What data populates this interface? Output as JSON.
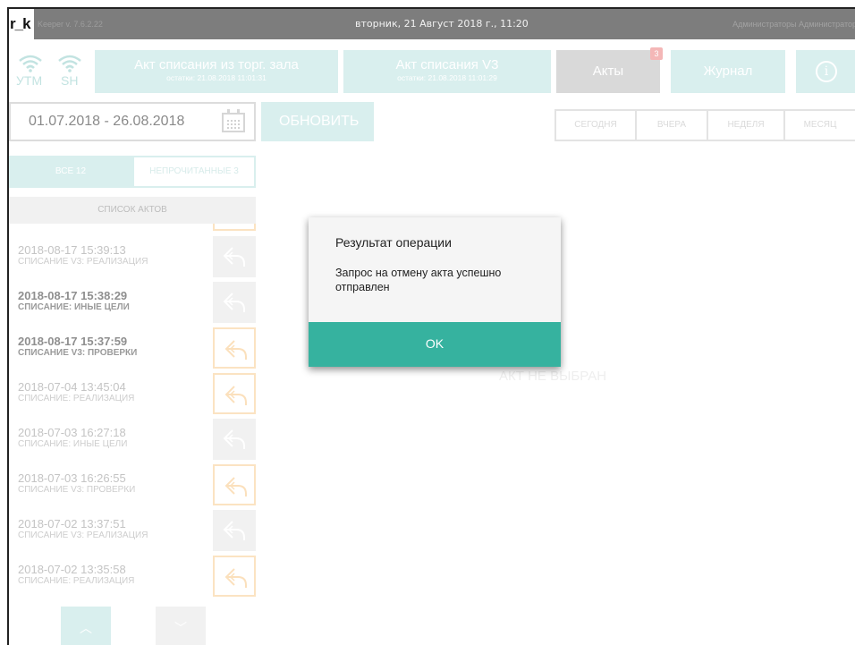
{
  "titlebar": {
    "logo": "r_k",
    "app_version": "Keeper v. 7.6.2.22",
    "datetime": "вторник, 21 Август 2018 г., 11:20",
    "user": "Администраторы Администратор"
  },
  "status": {
    "utm_label": "УТМ",
    "sh_label": "SH"
  },
  "toolbar": {
    "tile1_title": "Акт списания из торг. зала",
    "tile1_sub": "остатки: 21.08.2018 11:01:31",
    "tile2_title": "Акт списания V3",
    "tile2_sub": "остатки: 21.08.2018 11:01:29",
    "acts_label": "Акты",
    "acts_badge": "3",
    "journal_label": "Журнал",
    "info_icon": "i"
  },
  "filters": {
    "date_range": "01.07.2018 - 26.08.2018",
    "refresh_label": "ОБНОВИТЬ",
    "periods": [
      "СЕГОДНЯ",
      "ВЧЕРА",
      "НЕДЕЛЯ",
      "МЕСЯЦ"
    ]
  },
  "sidebar": {
    "all_label": "ВСЕ 12",
    "unread_label": "НЕПРОЧИТАННЫЕ 3",
    "list_header": "СПИСОК АКТОВ",
    "items": [
      {
        "datetime": "2018-08-17  15:39:13",
        "type": "СПИСАНИЕ V3: РЕАЛИЗАЦИЯ",
        "bold": false,
        "undo": "grey"
      },
      {
        "datetime": "2018-08-17  15:38:29",
        "type": "СПИСАНИЕ: ИНЫЕ ЦЕЛИ",
        "bold": true,
        "undo": "grey"
      },
      {
        "datetime": "2018-08-17  15:37:59",
        "type": "СПИСАНИЕ V3: ПРОВЕРКИ",
        "bold": true,
        "undo": "orange"
      },
      {
        "datetime": "2018-07-04  13:45:04",
        "type": "СПИСАНИЕ: РЕАЛИЗАЦИЯ",
        "bold": false,
        "undo": "orange"
      },
      {
        "datetime": "2018-07-03  16:27:18",
        "type": "СПИСАНИЕ: ИНЫЕ ЦЕЛИ",
        "bold": false,
        "undo": "grey"
      },
      {
        "datetime": "2018-07-03  16:26:55",
        "type": "СПИСАНИЕ V3: ПРОВЕРКИ",
        "bold": false,
        "undo": "orange"
      },
      {
        "datetime": "2018-07-02  13:37:51",
        "type": "СПИСАНИЕ V3: РЕАЛИЗАЦИЯ",
        "bold": false,
        "undo": "grey"
      },
      {
        "datetime": "2018-07-02  13:35:58",
        "type": "СПИСАНИЕ: РЕАЛИЗАЦИЯ",
        "bold": false,
        "undo": "orange"
      }
    ],
    "up_icon": "︿",
    "down_icon": "﹀"
  },
  "main": {
    "empty_message": "АКТ НЕ ВЫБРАН"
  },
  "dialog": {
    "title": "Результат операции",
    "message": "Запрос на отмену акта успешно отправлен",
    "ok_label": "OK"
  },
  "colors": {
    "accent": "#36b29f",
    "tile": "#d9efee",
    "undo_orange": "#fbe3c2",
    "badge": "#f4b7b7"
  }
}
